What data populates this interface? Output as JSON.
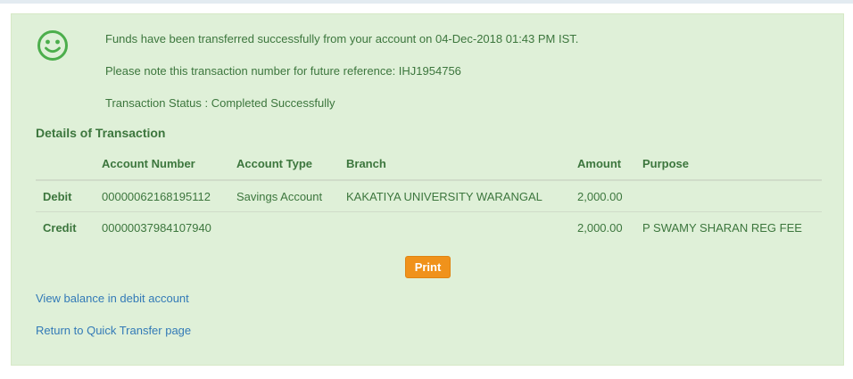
{
  "message": {
    "line1": "Funds have been transferred successfully from your account on  04-Dec-2018 01:43 PM IST.",
    "line2": "Please note this transaction number for future reference: IHJ1954756",
    "line3": "Transaction Status : Completed Successfully"
  },
  "details_title": "Details of Transaction",
  "table": {
    "headers": [
      "",
      "Account Number",
      "Account Type",
      "Branch",
      "Amount",
      "Purpose"
    ],
    "rows": [
      [
        "Debit",
        "00000062168195112",
        "Savings Account",
        "KAKATIYA UNIVERSITY WARANGAL",
        "2,000.00",
        ""
      ],
      [
        "Credit",
        "00000037984107940",
        "",
        "",
        "2,000.00",
        "P SWAMY SHARAN REG FEE"
      ]
    ]
  },
  "print_label": "Print",
  "links": {
    "view_balance": "View balance in debit account",
    "return_quick_transfer": "Return to Quick Transfer page"
  },
  "colors": {
    "panel_bg": "#dff0d8",
    "text": "#3c763d",
    "link": "#337ab7",
    "button": "#f0921b"
  },
  "icons": {
    "status": "smiley-icon"
  }
}
